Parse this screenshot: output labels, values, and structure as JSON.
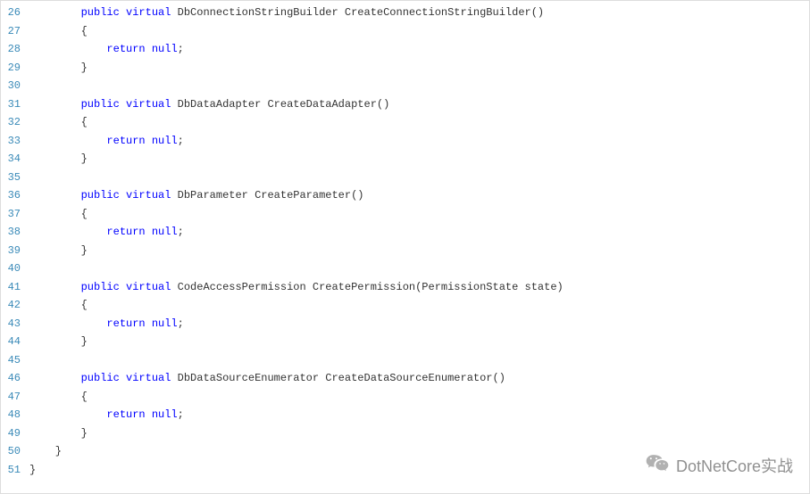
{
  "watermark": {
    "text": "DotNetCore实战"
  },
  "lines": [
    {
      "num": 26,
      "tokens": [
        [
          "        ",
          null
        ],
        [
          "public",
          "kw"
        ],
        [
          " ",
          null
        ],
        [
          "virtual",
          "kw"
        ],
        [
          " DbConnectionStringBuilder CreateConnectionStringBuilder()",
          null
        ]
      ]
    },
    {
      "num": 27,
      "tokens": [
        [
          "        {",
          null
        ]
      ]
    },
    {
      "num": 28,
      "tokens": [
        [
          "            ",
          null
        ],
        [
          "return",
          "kw"
        ],
        [
          " ",
          null
        ],
        [
          "null",
          "kw"
        ],
        [
          ";",
          null
        ]
      ]
    },
    {
      "num": 29,
      "tokens": [
        [
          "        }",
          null
        ]
      ]
    },
    {
      "num": 30,
      "tokens": [
        [
          "",
          null
        ]
      ]
    },
    {
      "num": 31,
      "tokens": [
        [
          "        ",
          null
        ],
        [
          "public",
          "kw"
        ],
        [
          " ",
          null
        ],
        [
          "virtual",
          "kw"
        ],
        [
          " DbDataAdapter CreateDataAdapter()",
          null
        ]
      ]
    },
    {
      "num": 32,
      "tokens": [
        [
          "        {",
          null
        ]
      ]
    },
    {
      "num": 33,
      "tokens": [
        [
          "            ",
          null
        ],
        [
          "return",
          "kw"
        ],
        [
          " ",
          null
        ],
        [
          "null",
          "kw"
        ],
        [
          ";",
          null
        ]
      ]
    },
    {
      "num": 34,
      "tokens": [
        [
          "        }",
          null
        ]
      ]
    },
    {
      "num": 35,
      "tokens": [
        [
          "",
          null
        ]
      ]
    },
    {
      "num": 36,
      "tokens": [
        [
          "        ",
          null
        ],
        [
          "public",
          "kw"
        ],
        [
          " ",
          null
        ],
        [
          "virtual",
          "kw"
        ],
        [
          " DbParameter CreateParameter()",
          null
        ]
      ]
    },
    {
      "num": 37,
      "tokens": [
        [
          "        {",
          null
        ]
      ]
    },
    {
      "num": 38,
      "tokens": [
        [
          "            ",
          null
        ],
        [
          "return",
          "kw"
        ],
        [
          " ",
          null
        ],
        [
          "null",
          "kw"
        ],
        [
          ";",
          null
        ]
      ]
    },
    {
      "num": 39,
      "tokens": [
        [
          "        }",
          null
        ]
      ]
    },
    {
      "num": 40,
      "tokens": [
        [
          "",
          null
        ]
      ]
    },
    {
      "num": 41,
      "tokens": [
        [
          "        ",
          null
        ],
        [
          "public",
          "kw"
        ],
        [
          " ",
          null
        ],
        [
          "virtual",
          "kw"
        ],
        [
          " CodeAccessPermission CreatePermission(PermissionState state)",
          null
        ]
      ]
    },
    {
      "num": 42,
      "tokens": [
        [
          "        {",
          null
        ]
      ]
    },
    {
      "num": 43,
      "tokens": [
        [
          "            ",
          null
        ],
        [
          "return",
          "kw"
        ],
        [
          " ",
          null
        ],
        [
          "null",
          "kw"
        ],
        [
          ";",
          null
        ]
      ]
    },
    {
      "num": 44,
      "tokens": [
        [
          "        }",
          null
        ]
      ]
    },
    {
      "num": 45,
      "tokens": [
        [
          "",
          null
        ]
      ]
    },
    {
      "num": 46,
      "tokens": [
        [
          "        ",
          null
        ],
        [
          "public",
          "kw"
        ],
        [
          " ",
          null
        ],
        [
          "virtual",
          "kw"
        ],
        [
          " DbDataSourceEnumerator CreateDataSourceEnumerator()",
          null
        ]
      ]
    },
    {
      "num": 47,
      "tokens": [
        [
          "        {",
          null
        ]
      ]
    },
    {
      "num": 48,
      "tokens": [
        [
          "            ",
          null
        ],
        [
          "return",
          "kw"
        ],
        [
          " ",
          null
        ],
        [
          "null",
          "kw"
        ],
        [
          ";",
          null
        ]
      ]
    },
    {
      "num": 49,
      "tokens": [
        [
          "        }",
          null
        ]
      ]
    },
    {
      "num": 50,
      "tokens": [
        [
          "    }",
          null
        ]
      ]
    },
    {
      "num": 51,
      "tokens": [
        [
          "}",
          null
        ]
      ]
    }
  ]
}
